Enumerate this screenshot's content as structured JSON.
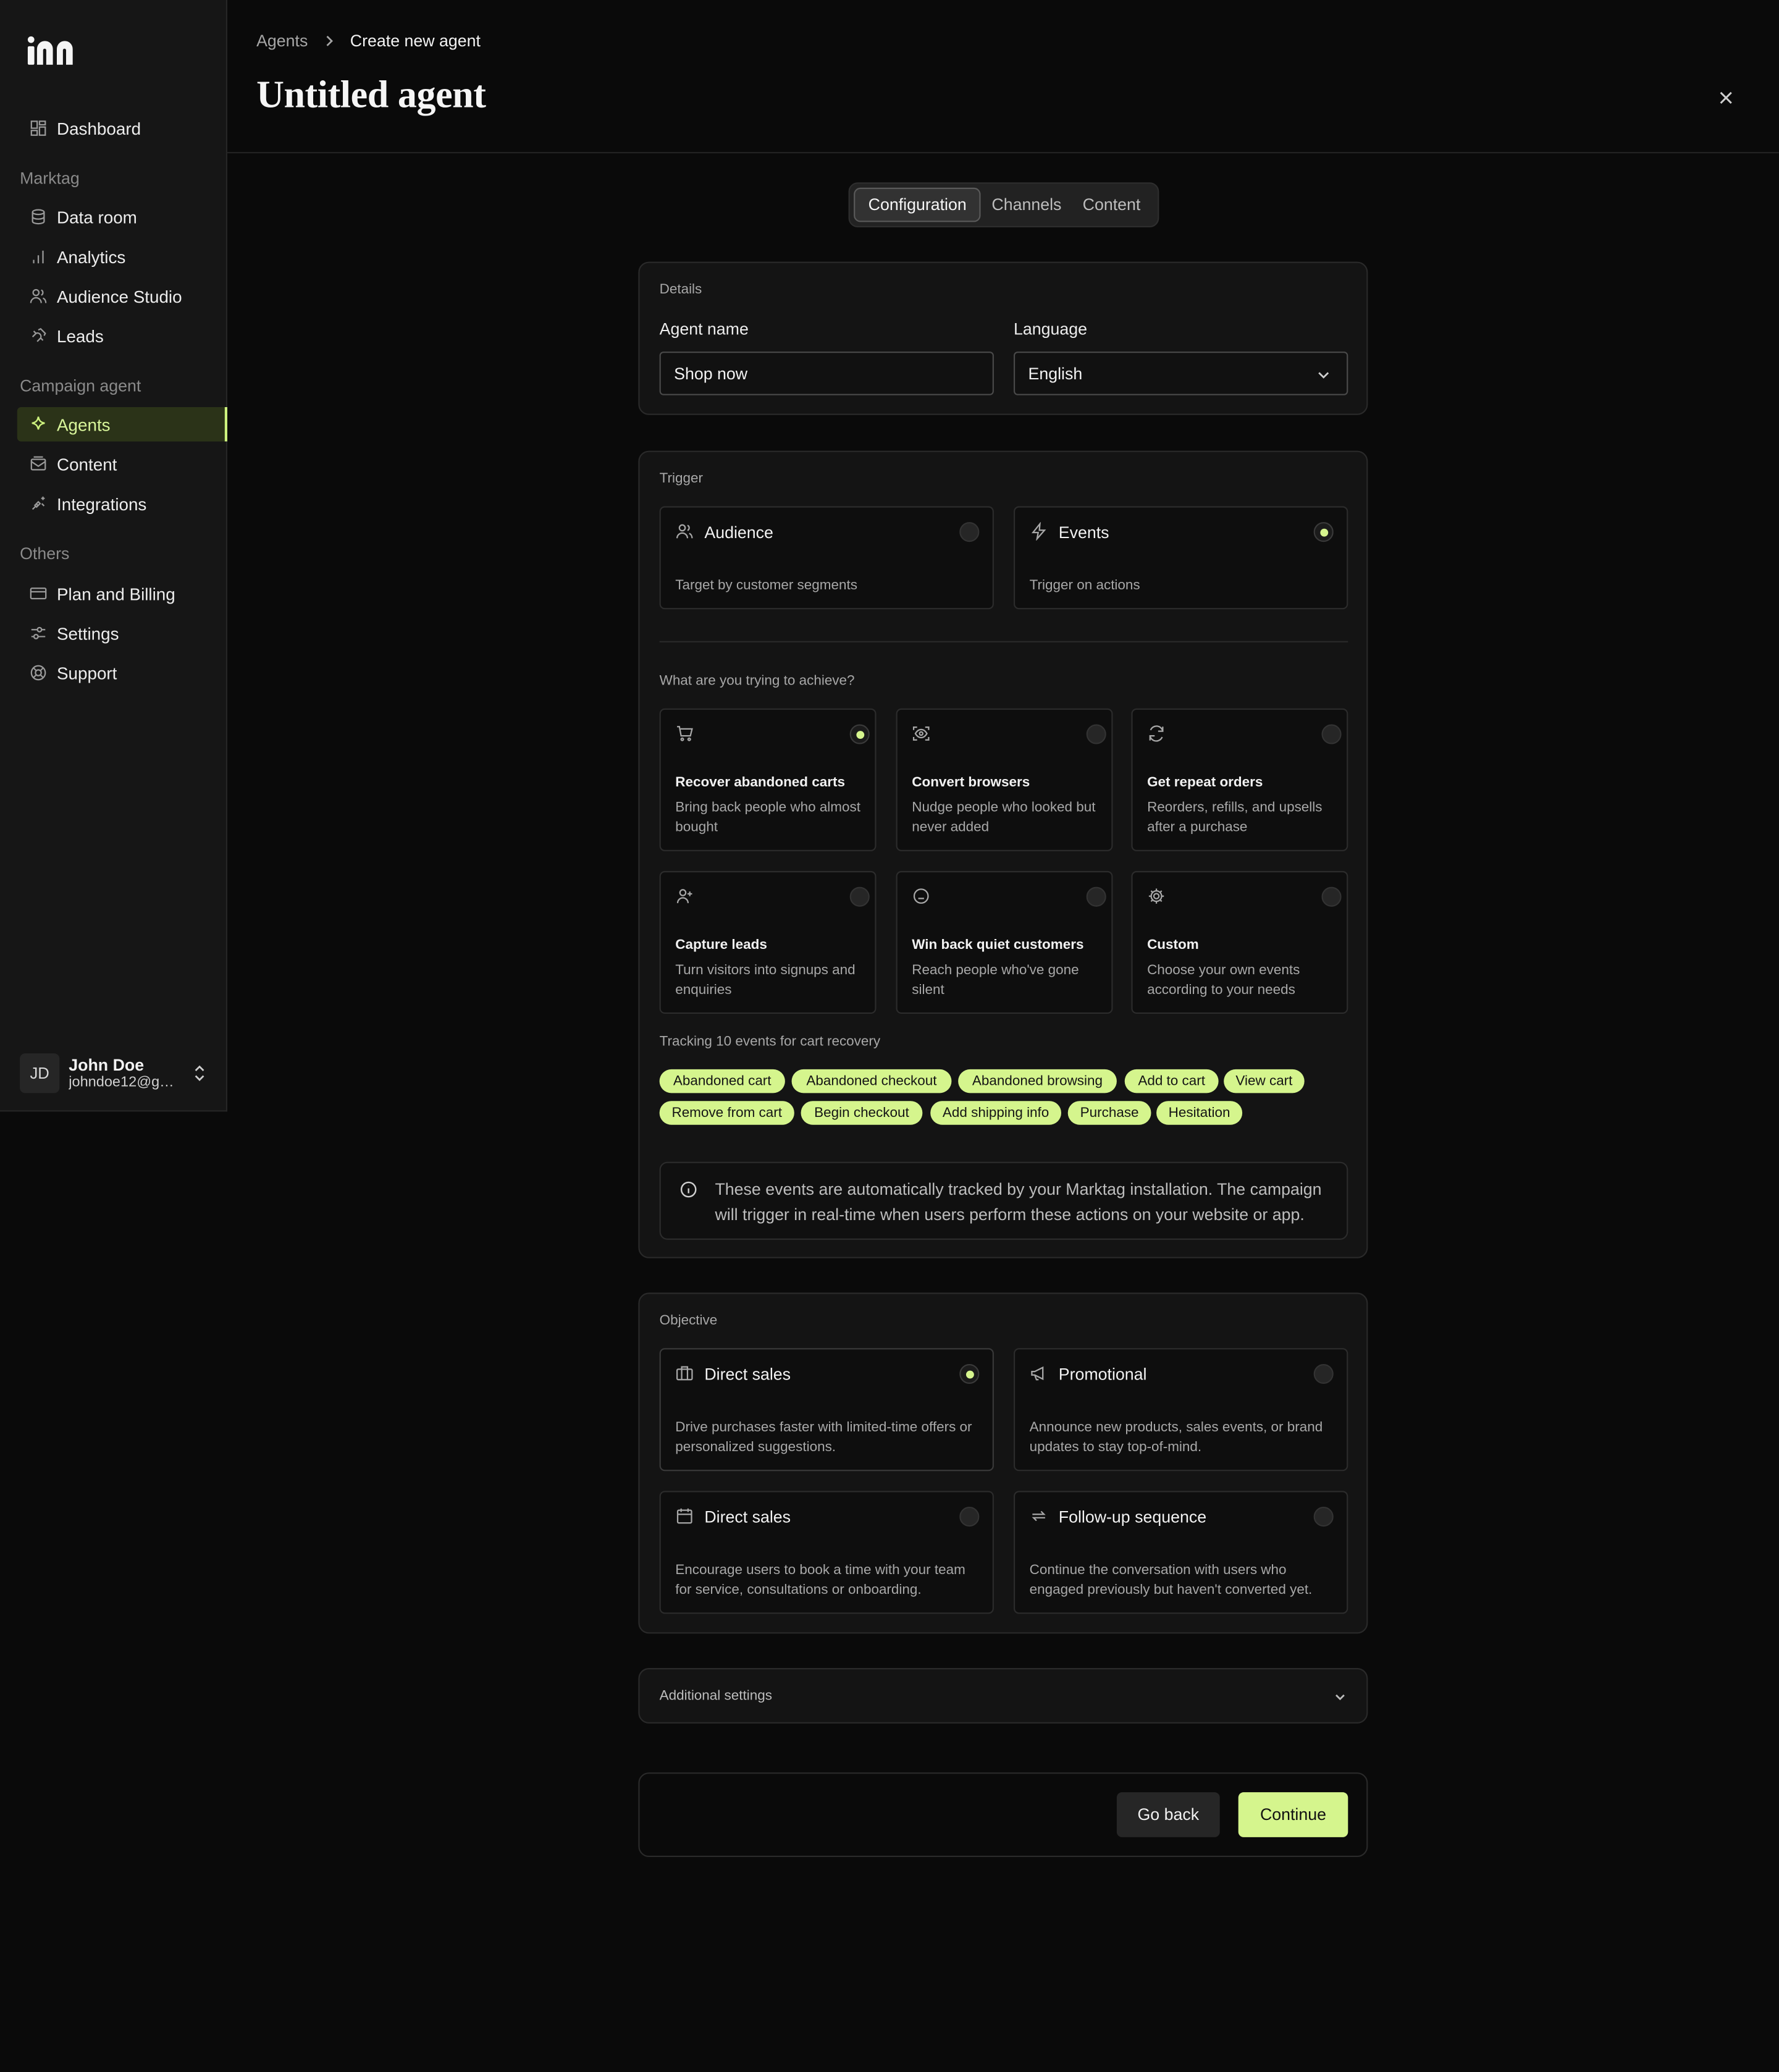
{
  "sidebar": {
    "logo": "m",
    "top_item": {
      "label": "Dashboard",
      "icon": "dashboard-icon"
    },
    "sections": [
      {
        "title": "Marktag",
        "items": [
          {
            "label": "Data room",
            "icon": "database-icon"
          },
          {
            "label": "Analytics",
            "icon": "bar-chart-icon"
          },
          {
            "label": "Audience Studio",
            "icon": "users-icon"
          },
          {
            "label": "Leads",
            "icon": "magnet-icon"
          }
        ]
      },
      {
        "title": "Campaign agent",
        "items": [
          {
            "label": "Agents",
            "icon": "sparkle-icon",
            "active": true
          },
          {
            "label": "Content",
            "icon": "mail-stack-icon"
          },
          {
            "label": "Integrations",
            "icon": "plug-icon"
          }
        ]
      },
      {
        "title": "Others",
        "items": [
          {
            "label": "Plan and Billing",
            "icon": "credit-card-icon"
          },
          {
            "label": "Settings",
            "icon": "sliders-icon"
          },
          {
            "label": "Support",
            "icon": "lifebuoy-icon"
          }
        ]
      }
    ],
    "user": {
      "initials": "JD",
      "name": "John Doe",
      "email": "johndoe12@gmail.com"
    }
  },
  "header": {
    "breadcrumb": [
      "Agents",
      "Create new agent"
    ],
    "title": "Untitled agent"
  },
  "tabs": [
    {
      "label": "Configuration",
      "active": true
    },
    {
      "label": "Channels"
    },
    {
      "label": "Content"
    }
  ],
  "details": {
    "section_label": "Details",
    "agent_name_label": "Agent name",
    "agent_name_value": "Shop now",
    "language_label": "Language",
    "language_value": "English"
  },
  "trigger": {
    "section_label": "Trigger",
    "options": [
      {
        "title": "Audience",
        "desc": "Target by customer segments",
        "icon": "users-icon",
        "selected": false
      },
      {
        "title": "Events",
        "desc": "Trigger on actions",
        "icon": "lightning-icon",
        "selected": true
      }
    ],
    "goal_question": "What are you trying to achieve?",
    "goals": [
      {
        "title": "Recover abandoned carts",
        "desc": "Bring back people who almost bought",
        "icon": "cart-icon",
        "selected": true
      },
      {
        "title": "Convert browsers",
        "desc": "Nudge people who looked but never added",
        "icon": "eye-scan-icon",
        "selected": false
      },
      {
        "title": "Get repeat orders",
        "desc": "Reorders, refills, and upsells after a purchase",
        "icon": "refresh-icon",
        "selected": false
      },
      {
        "title": "Capture leads",
        "desc": "Turn visitors into signups and enquiries",
        "icon": "user-plus-icon",
        "selected": false
      },
      {
        "title": "Win back quiet customers",
        "desc": "Reach people who've gone silent",
        "icon": "face-icon",
        "selected": false
      },
      {
        "title": "Custom",
        "desc": "Choose your own events according to your needs",
        "icon": "gear-icon",
        "selected": false
      }
    ],
    "tracking_label": "Tracking 10 events for cart recovery",
    "events": [
      "Abandoned cart",
      "Abandoned checkout",
      "Abandoned browsing",
      "Add to cart",
      "View cart",
      "Remove from cart",
      "Begin checkout",
      "Add shipping info",
      "Purchase",
      "Hesitation"
    ],
    "info_text": "These events are automatically tracked by your Marktag installation. The campaign will trigger in real-time when users perform these actions on your website or app."
  },
  "objective": {
    "section_label": "Objective",
    "options": [
      {
        "title": "Direct sales",
        "desc": "Drive purchases faster with limited-time offers or personalized suggestions.",
        "icon": "briefcase-icon",
        "selected": true
      },
      {
        "title": "Promotional",
        "desc": "Announce new products, sales events, or brand updates to stay top-of-mind.",
        "icon": "megaphone-icon",
        "selected": false
      },
      {
        "title": "Direct sales",
        "desc": "Encourage users to book a time with your team for service, consultations or onboarding.",
        "icon": "calendar-icon",
        "selected": false
      },
      {
        "title": "Follow-up sequence",
        "desc": "Continue the conversation with users who engaged previously but haven't converted yet.",
        "icon": "repeat-icon",
        "selected": false
      }
    ]
  },
  "additional_settings": {
    "label": "Additional settings"
  },
  "footer": {
    "back_label": "Go back",
    "continue_label": "Continue"
  },
  "colors": {
    "accent": "#d5f58d",
    "background": "#0a0a0a",
    "surface": "#141414"
  }
}
